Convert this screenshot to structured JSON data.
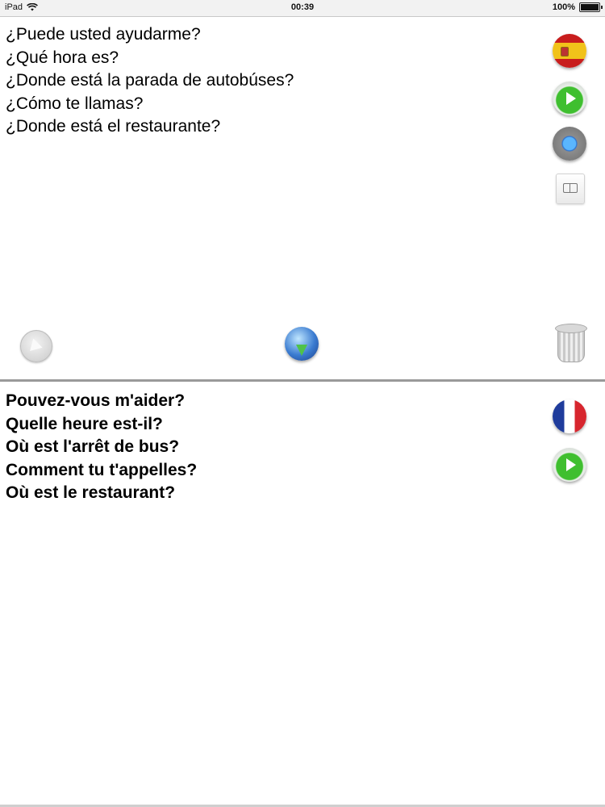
{
  "status_bar": {
    "carrier": "iPad",
    "wifi_icon": "wifi-icon",
    "time": "00:39",
    "battery_text": "100%",
    "battery_level": 1.0,
    "battery_icon": "battery-icon"
  },
  "source": {
    "language_flag": "spain-flag-icon",
    "phrases": [
      "¿Puede usted ayudarme?",
      "¿Qué hora es?",
      "¿Donde está la parada de autobúses?",
      "¿Cómo te llamas?",
      "¿Donde está el restaurante?"
    ],
    "actions": [
      "play-icon",
      "record-icon",
      "phrasebook-icon"
    ]
  },
  "toolbar": {
    "left": "back-icon",
    "center": "translate-globe-icon",
    "right": "trash-icon"
  },
  "target": {
    "language_flag": "france-flag-icon",
    "phrases": [
      "Pouvez-vous m'aider?",
      "Quelle heure est-il?",
      "Où est l'arrêt de bus?",
      "Comment tu t'appelles?",
      "Où est le restaurant?"
    ],
    "actions": [
      "play-icon"
    ]
  },
  "colors": {
    "background": "#ffffff",
    "divider": "#9a9a9a",
    "play_green": "#3fbf2f"
  }
}
